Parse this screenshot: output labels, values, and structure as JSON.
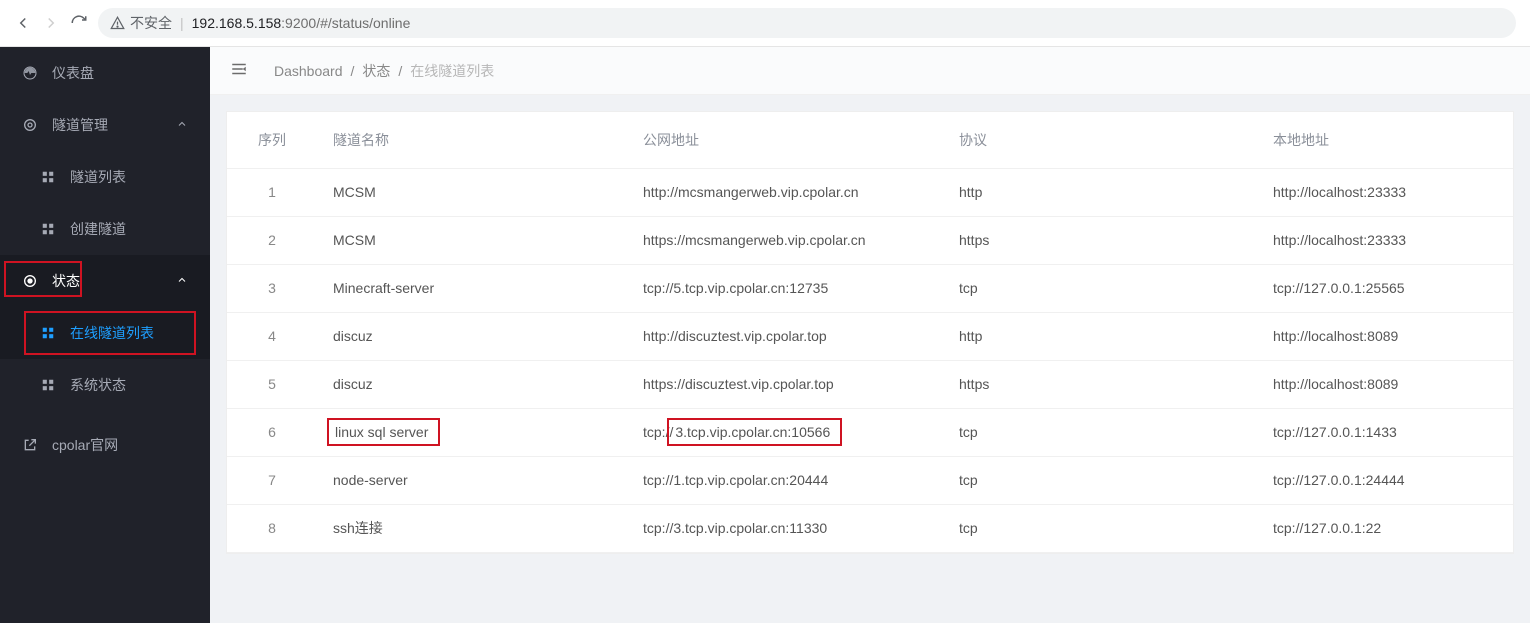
{
  "browser": {
    "insecure_label": "不安全",
    "url_host": "192.168.5.158",
    "url_port_path": ":9200/#/status/online"
  },
  "sidebar": {
    "dashboard": "仪表盘",
    "tunnel_mgmt": "隧道管理",
    "tunnel_list": "隧道列表",
    "tunnel_create": "创建隧道",
    "status": "状态",
    "online_list": "在线隧道列表",
    "system_status": "系统状态",
    "cpolar_site": "cpolar官网"
  },
  "breadcrumb": {
    "root": "Dashboard",
    "mid": "状态",
    "leaf": "在线隧道列表"
  },
  "columns": {
    "index": "序列",
    "name": "隧道名称",
    "public": "公网地址",
    "proto": "协议",
    "local": "本地地址"
  },
  "rows": [
    {
      "i": "1",
      "name": "MCSM",
      "public": "http://mcsmangerweb.vip.cpolar.cn",
      "proto": "http",
      "local": "http://localhost:23333"
    },
    {
      "i": "2",
      "name": "MCSM",
      "public": "https://mcsmangerweb.vip.cpolar.cn",
      "proto": "https",
      "local": "http://localhost:23333"
    },
    {
      "i": "3",
      "name": "Minecraft-server",
      "public": "tcp://5.tcp.vip.cpolar.cn:12735",
      "proto": "tcp",
      "local": "tcp://127.0.0.1:25565"
    },
    {
      "i": "4",
      "name": "discuz",
      "public": "http://discuztest.vip.cpolar.top",
      "proto": "http",
      "local": "http://localhost:8089"
    },
    {
      "i": "5",
      "name": "discuz",
      "public": "https://discuztest.vip.cpolar.top",
      "proto": "https",
      "local": "http://localhost:8089"
    },
    {
      "i": "6",
      "name": "linux sql server",
      "public": "tcp://3.tcp.vip.cpolar.cn:10566",
      "proto": "tcp",
      "local": "tcp://127.0.0.1:1433",
      "hl": true
    },
    {
      "i": "7",
      "name": "node-server",
      "public": "tcp://1.tcp.vip.cpolar.cn:20444",
      "proto": "tcp",
      "local": "tcp://127.0.0.1:24444"
    },
    {
      "i": "8",
      "name": "ssh连接",
      "public": "tcp://3.tcp.vip.cpolar.cn:11330",
      "proto": "tcp",
      "local": "tcp://127.0.0.1:22"
    }
  ]
}
